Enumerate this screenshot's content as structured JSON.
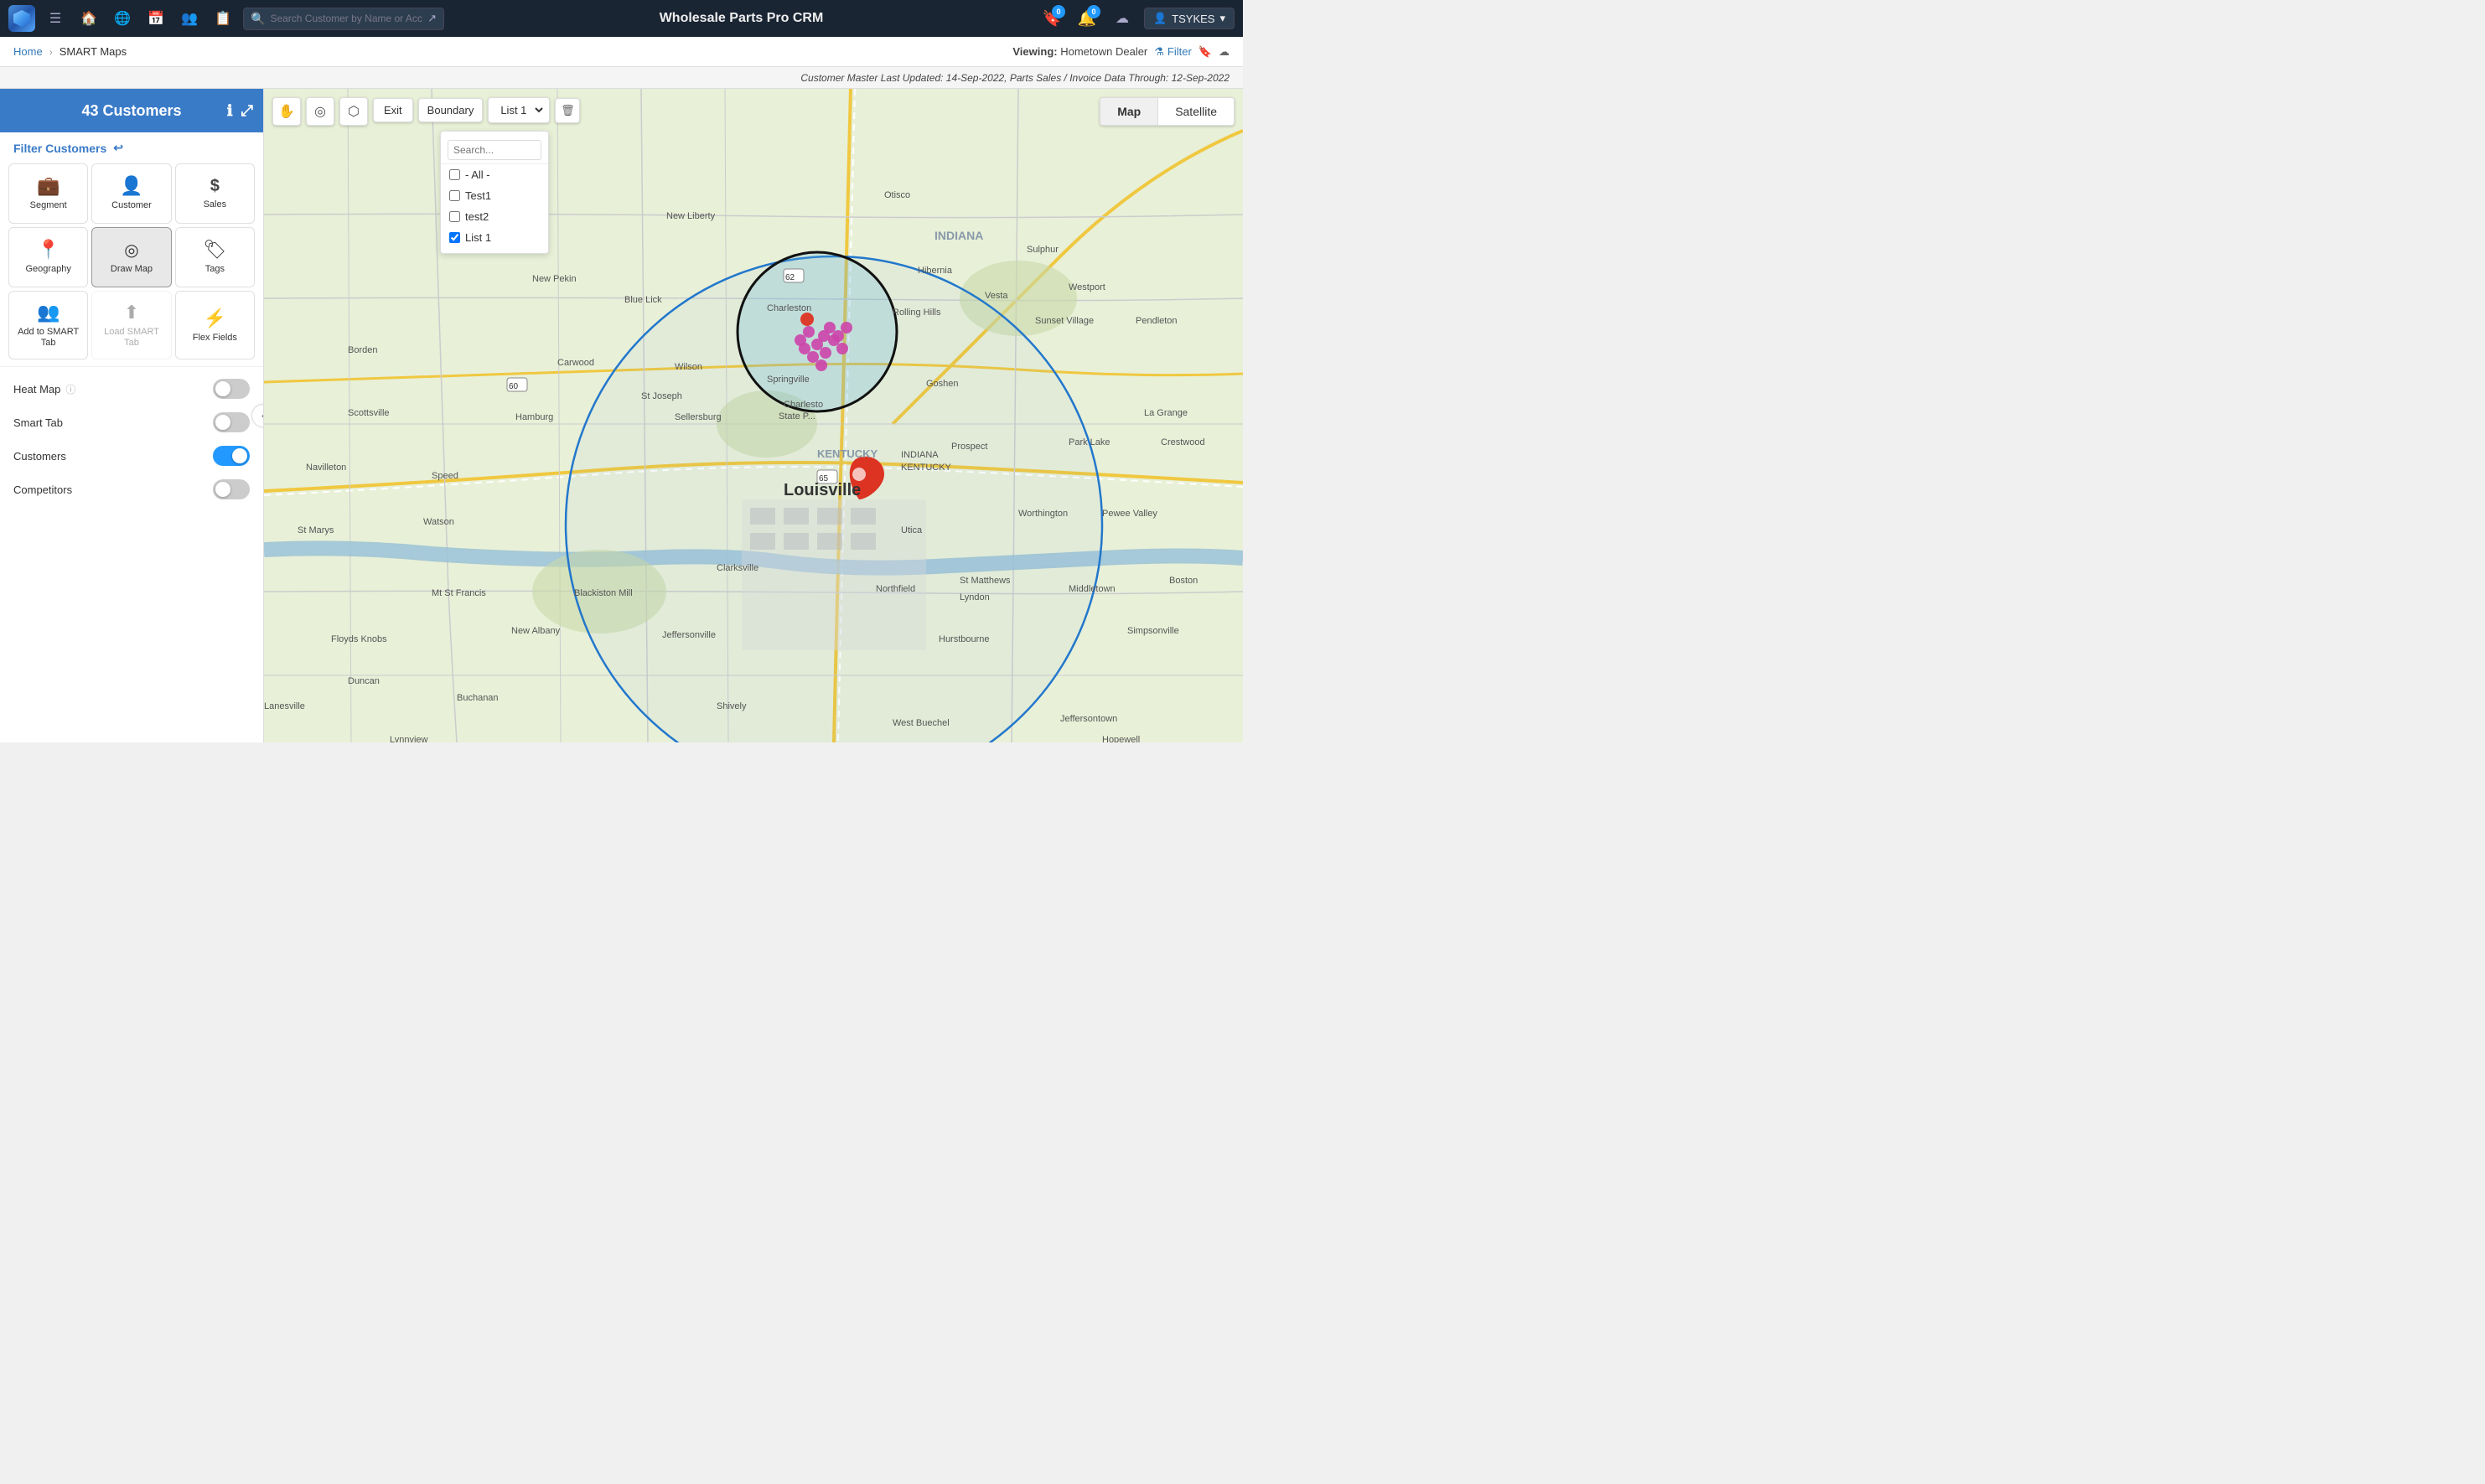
{
  "app": {
    "title": "Wholesale Parts Pro CRM",
    "logo_alt": "App Logo"
  },
  "nav": {
    "search_placeholder": "Search Customer by Name or Account #",
    "notifications_count": "0",
    "alerts_count": "0",
    "user": {
      "name": "TSYKES",
      "icon": "👤"
    },
    "icons": {
      "menu": "☰",
      "home": "🏠",
      "globe": "🌐",
      "calendar": "📅",
      "people": "👥",
      "task": "📋",
      "external": "↗",
      "bookmark": "🔖",
      "bell": "🔔",
      "cloud": "☁",
      "chevron_down": "▾"
    }
  },
  "breadcrumb": {
    "home_label": "Home",
    "current_label": "SMART Maps",
    "viewing_prefix": "Viewing:",
    "viewing_value": "Hometown Dealer",
    "filter_label": "Filter"
  },
  "data_note": {
    "text": "Customer Master Last Updated: 14-Sep-2022, Parts Sales / Invoice Data Through: 12-Sep-2022"
  },
  "sidebar": {
    "customer_count": "43 Customers",
    "filter_section_label": "Filter Customers",
    "reset_icon": "↩",
    "filter_buttons": [
      {
        "id": "segment",
        "label": "Segment",
        "icon": "💼",
        "active": false
      },
      {
        "id": "customer",
        "label": "Customer",
        "icon": "👤",
        "active": false
      },
      {
        "id": "sales",
        "label": "Sales",
        "icon": "$",
        "active": false
      },
      {
        "id": "geography",
        "label": "Geography",
        "icon": "📍",
        "active": false
      },
      {
        "id": "draw-map",
        "label": "Draw Map",
        "icon": "⊙",
        "active": true
      },
      {
        "id": "tags",
        "label": "Tags",
        "icon": "🏷",
        "active": false
      },
      {
        "id": "add-smart-tab",
        "label": "Add to SMART Tab",
        "icon": "👥",
        "active": false
      },
      {
        "id": "load-smart-tab",
        "label": "Load SMART Tab",
        "icon": "⬆",
        "active": false,
        "disabled": true
      },
      {
        "id": "flex-fields",
        "label": "Flex Fields",
        "icon": "⚡",
        "active": false
      }
    ],
    "toggles": [
      {
        "id": "heat-map",
        "label": "Heat Map",
        "has_info": true,
        "on": false
      },
      {
        "id": "smart-tab",
        "label": "Smart Tab",
        "has_info": false,
        "on": false
      },
      {
        "id": "customers",
        "label": "Customers",
        "has_info": false,
        "on": true
      },
      {
        "id": "competitors",
        "label": "Competitors",
        "has_info": false,
        "on": false
      }
    ]
  },
  "map": {
    "exit_btn": "Exit",
    "boundary_label": "Boundary",
    "boundary_list_value": "List 1",
    "boundary_options": [
      {
        "id": "all",
        "label": "- All -",
        "checked": false
      },
      {
        "id": "test1",
        "label": "Test1",
        "checked": false
      },
      {
        "id": "test2",
        "label": "test2",
        "checked": false
      },
      {
        "id": "list1",
        "label": "List 1",
        "checked": true
      }
    ],
    "dropdown_search_placeholder": "Search...",
    "type_btns": [
      {
        "id": "map",
        "label": "Map",
        "active": true
      },
      {
        "id": "satellite",
        "label": "Satellite",
        "active": false
      }
    ],
    "city_label": "Louisville",
    "ctrl_icons": {
      "pan": "✋",
      "circle": "⊙",
      "polygon": "⊡"
    }
  }
}
